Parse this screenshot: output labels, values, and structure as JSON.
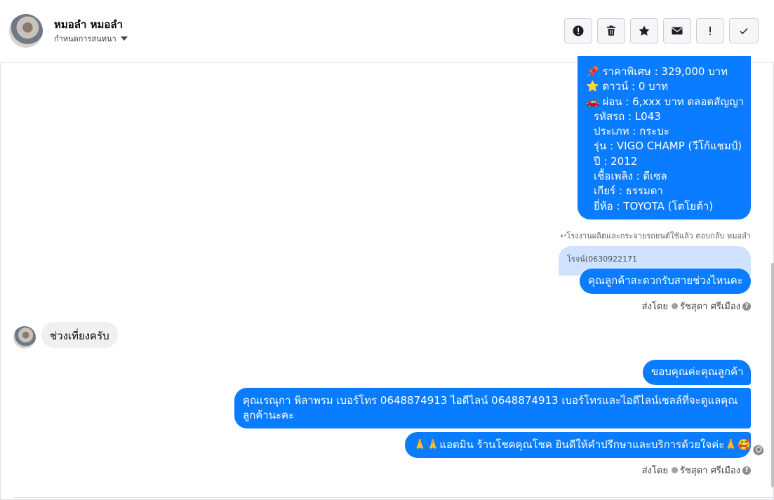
{
  "header": {
    "contact_name": "หมอลำ หมอลำ",
    "assign_label": "กำหนดการสนทนา",
    "actions": [
      {
        "icon": "alert-circle-icon"
      },
      {
        "icon": "trash-icon"
      },
      {
        "icon": "star-icon"
      },
      {
        "icon": "envelope-icon"
      },
      {
        "icon": "exclamation-icon"
      },
      {
        "icon": "check-icon"
      }
    ]
  },
  "messages": {
    "car_details": {
      "lines": [
        "📌 ราคาพิเศษ : 329,000 บาท",
        "⭐ ดาวน์ : 0 บาท",
        "🚗 ผ่อน : 6,xxx บาท ตลอดสัญญา",
        "รหัสรถ : L043",
        "ประเภท : กระบะ",
        "รุ่น : VIGO CHAMP (วีโก้แชมป์)",
        "ปี : 2012",
        "เชื้อเพลิง : ดีเซล",
        "เกียร์ : ธรรมดา",
        "ยี่ห้อ : TOYOTA (โตโยต้า)"
      ]
    },
    "reply_note": "↩โรงงานผลิตและกระจายรถยนต์ใช้แล้ว ตอบกลับ หมอลำ",
    "quoted_text": "โรจน์(0630922171",
    "ask_time": "คุณลูกค้าสะดวกรับสายช่วงไหนคะ",
    "sent_by_label": "ส่งโดย",
    "sender_name": "รัชสุดา ศรีเมือง",
    "incoming": "ช่วงเที่ยงครับ",
    "thanks": "ขอบคุณค่ะคุณลูกค้า",
    "contact_info": "คุณเรณุกา พิลาพรม        เบอร์โทร 0648874913  ไอดีไลน์ 0648874913   เบอร์โทรและไอดีไลน์เซลล์ที่จะดูแลคุณลูกค้านะคะ",
    "admin_msg": "🙏🙏แอดมิน ร้านโชคคุณโชค ยินดีให้คำปรึกษาและบริการด้วยใจค่ะ🙏🥰"
  },
  "colors": {
    "outgoing_bubble": "#0a7cff",
    "incoming_bubble": "#f0f0f0",
    "quoted_bubble": "#cfe2ff"
  }
}
